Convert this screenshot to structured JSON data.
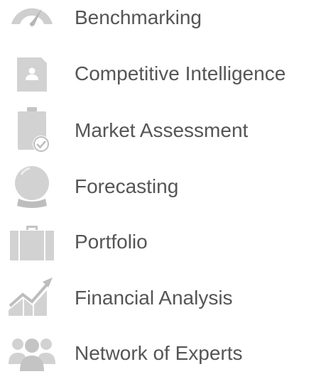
{
  "colors": {
    "icon": "#cfcfcf",
    "icon_dark": "#a9a9a9",
    "text": "#555555"
  },
  "items": [
    {
      "label": "Benchmarking",
      "icon": "speedometer-icon"
    },
    {
      "label": "Competitive Intelligence",
      "icon": "id-card-icon"
    },
    {
      "label": "Market Assessment",
      "icon": "clipboard-check-icon"
    },
    {
      "label": "Forecasting",
      "icon": "crystal-ball-icon"
    },
    {
      "label": "Portfolio",
      "icon": "briefcase-icon"
    },
    {
      "label": "Financial Analysis",
      "icon": "growth-chart-icon"
    },
    {
      "label": "Network of Experts",
      "icon": "people-group-icon"
    }
  ]
}
